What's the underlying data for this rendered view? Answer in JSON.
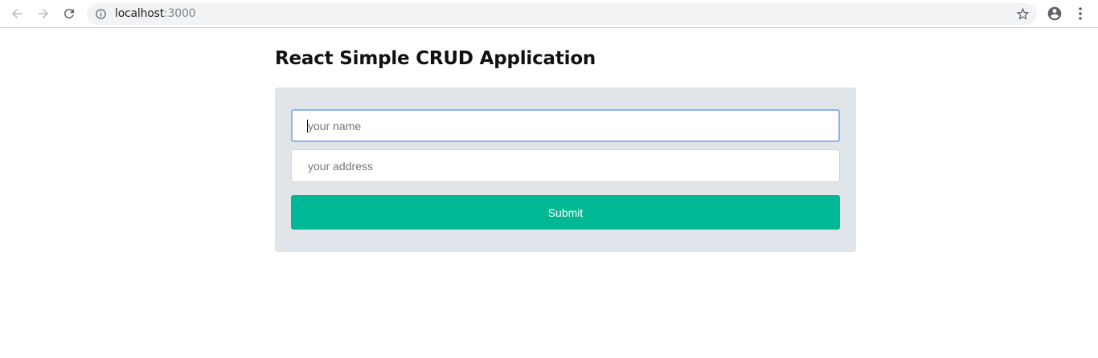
{
  "browser": {
    "url_host": "localhost",
    "url_port": ":3000"
  },
  "page": {
    "title": "React Simple CRUD Application"
  },
  "form": {
    "name_placeholder": "your name",
    "name_value": "",
    "address_placeholder": "your address",
    "address_value": "",
    "submit_label": "Submit"
  },
  "colors": {
    "card_bg": "#dfe5e8",
    "submit_bg": "#00b894",
    "focus_border": "#8fb3ea"
  },
  "icons": {
    "back": "arrow-left-icon",
    "forward": "arrow-right-icon",
    "reload": "reload-icon",
    "site_info": "info-icon",
    "bookmark": "star-icon",
    "profile": "account-circle-icon",
    "menu": "more-vert-icon"
  }
}
